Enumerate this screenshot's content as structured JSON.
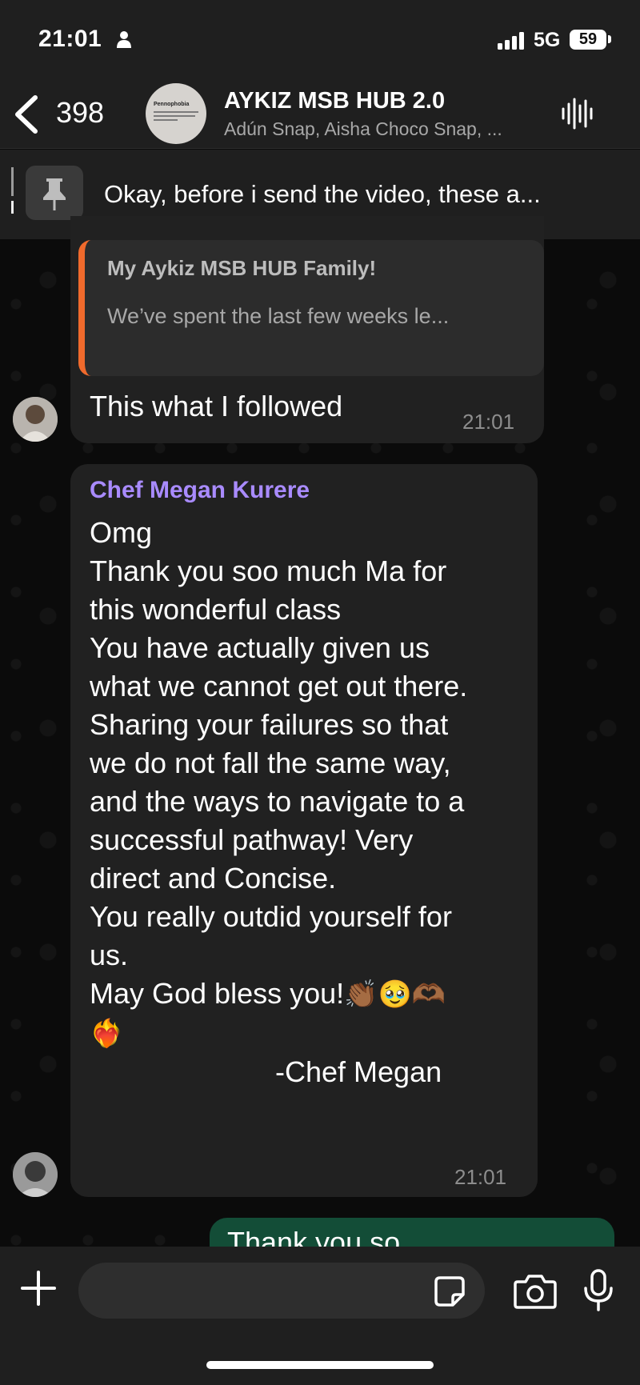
{
  "status_bar": {
    "time": "21:01",
    "network": "5G",
    "battery": "59"
  },
  "header": {
    "unread_count": "398",
    "group_name": "AYKIZ MSB HUB 2.0",
    "members": "Adún Snap, Aisha Choco Snap, ...",
    "avatar_text": "Pennophobia"
  },
  "pinned": {
    "text": "Okay, before i send the video, these a..."
  },
  "messages": [
    {
      "quote_title": "My Aykiz MSB HUB Family!",
      "quote_body": "We’ve spent the last few weeks le...",
      "text": "This what I followed",
      "time": "21:01"
    },
    {
      "sender": "Chef Megan Kurere",
      "lines": [
        "Omg",
        "Thank you soo much Ma for",
        "this wonderful class",
        "You have actually given us",
        "what we cannot get out there.",
        "Sharing your failures so that",
        "we do not fall the same way,",
        "and the ways to navigate to a",
        "successful pathway! Very",
        "direct and Concise.",
        "You really outdid yourself for",
        "us.",
        "May God bless you!"
      ],
      "emojis": [
        "👏🏾",
        "🥹",
        "🫶🏾",
        "❤️‍🔥"
      ],
      "signature": "-Chef Megan",
      "time": "21:01"
    },
    {
      "text": "Thank you so"
    }
  ],
  "composer": {
    "placeholder": ""
  },
  "colors": {
    "bar_bg": "#1f1f1f",
    "bubble_in": "#212121",
    "bubble_out": "#134d37",
    "quote_accent": "#f06a2c",
    "sender_name": "#a98bff",
    "time_text": "#8d8d8d"
  },
  "icons": [
    "person-icon",
    "signal-icon",
    "back-chevron-icon",
    "voice-waveform-icon",
    "pin-icon",
    "plus-icon",
    "sticker-icon",
    "camera-icon",
    "microphone-icon"
  ]
}
